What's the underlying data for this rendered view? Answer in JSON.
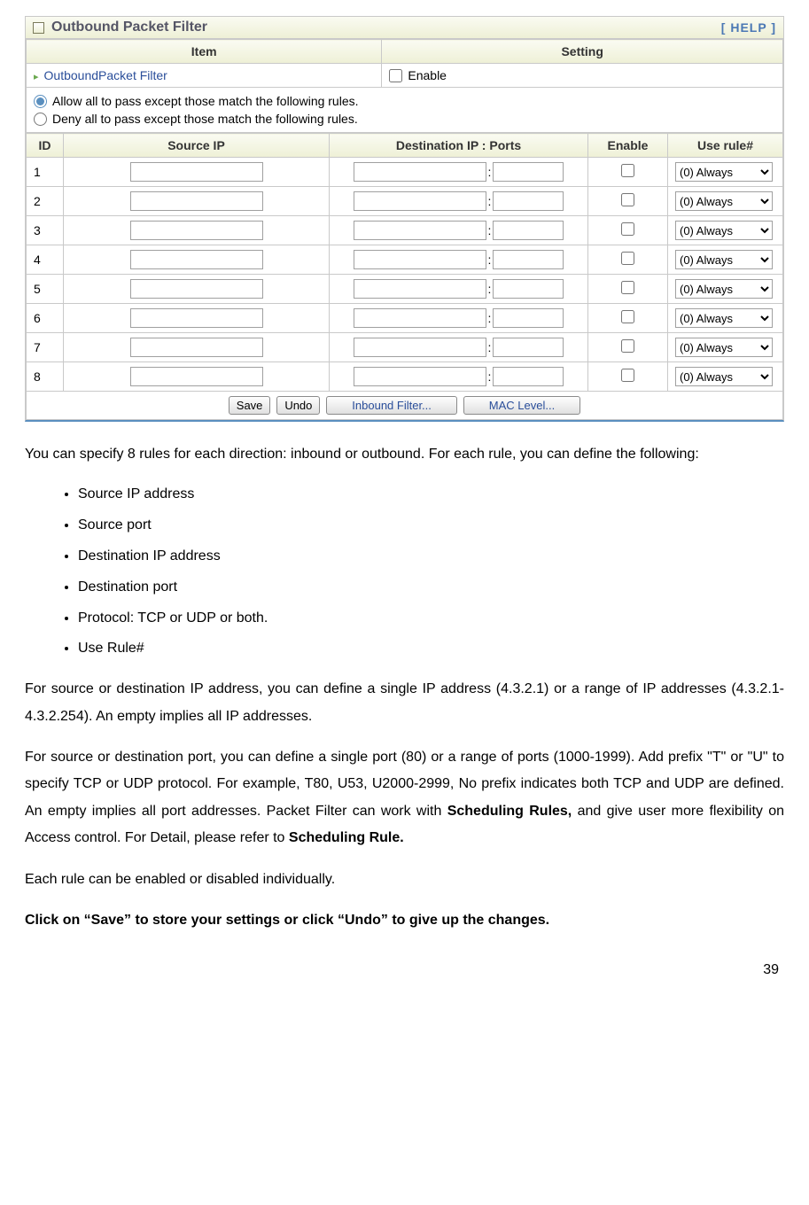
{
  "panel": {
    "title": "Outbound Packet Filter",
    "help": "[ HELP ]"
  },
  "settings_header": {
    "item": "Item",
    "setting": "Setting"
  },
  "item_row": {
    "name": "OutboundPacket Filter",
    "enable_label": "Enable",
    "enabled": false
  },
  "policy": {
    "allow": "Allow all to pass except those match the following rules.",
    "deny": "Deny all to pass except those match the following rules.",
    "selected": "allow"
  },
  "columns": {
    "id": "ID",
    "src": "Source IP",
    "dst": "Destination IP : Ports",
    "en": "Enable",
    "rule": "Use rule#"
  },
  "rows": [
    {
      "id": "1",
      "src": "",
      "dst_ip": "",
      "dst_port": "",
      "enabled": false,
      "rule": "(0) Always"
    },
    {
      "id": "2",
      "src": "",
      "dst_ip": "",
      "dst_port": "",
      "enabled": false,
      "rule": "(0) Always"
    },
    {
      "id": "3",
      "src": "",
      "dst_ip": "",
      "dst_port": "",
      "enabled": false,
      "rule": "(0) Always"
    },
    {
      "id": "4",
      "src": "",
      "dst_ip": "",
      "dst_port": "",
      "enabled": false,
      "rule": "(0) Always"
    },
    {
      "id": "5",
      "src": "",
      "dst_ip": "",
      "dst_port": "",
      "enabled": false,
      "rule": "(0) Always"
    },
    {
      "id": "6",
      "src": "",
      "dst_ip": "",
      "dst_port": "",
      "enabled": false,
      "rule": "(0) Always"
    },
    {
      "id": "7",
      "src": "",
      "dst_ip": "",
      "dst_port": "",
      "enabled": false,
      "rule": "(0) Always"
    },
    {
      "id": "8",
      "src": "",
      "dst_ip": "",
      "dst_port": "",
      "enabled": false,
      "rule": "(0) Always"
    }
  ],
  "buttons": {
    "save": "Save",
    "undo": "Undo",
    "inbound": "Inbound Filter...",
    "mac": "MAC Level..."
  },
  "doc": {
    "p1": "You can specify 8 rules for each direction: inbound or outbound. For each rule, you can define the following:",
    "bullets": [
      "Source IP address",
      "Source port",
      "Destination IP address",
      "Destination port",
      "Protocol: TCP or UDP or both.",
      "Use Rule#"
    ],
    "p2": "For source or destination IP address, you can define a single IP address (4.3.2.1) or a range of IP addresses (4.3.2.1-4.3.2.254). An empty implies all IP addresses.",
    "p3a": "For source or destination port, you can define a single port (80) or a range of ports (1000-1999). Add prefix \"T\" or \"U\" to specify TCP or UDP protocol. For example, T80, U53, U2000-2999, No prefix indicates both TCP and UDP are defined. An empty implies all port addresses. Packet Filter can work with ",
    "p3b": "Scheduling Rules,",
    "p3c": " and give user more flexibility on Access control. For Detail, please refer to ",
    "p3d": "Scheduling Rule.",
    "p4": "Each rule can be enabled or disabled individually.",
    "p5": "Click on “Save” to store your settings or click “Undo” to give up the changes.",
    "page_no": "39"
  }
}
